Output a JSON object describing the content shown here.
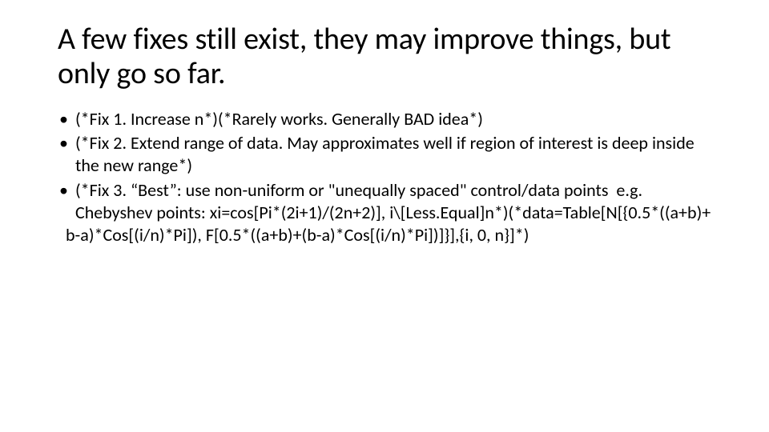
{
  "title": "A few fixes still exist, they may improve things, but only go so far.",
  "bullets": [
    "(*Fix 1. Increase n*)(*Rarely works. Generally BAD idea*)",
    "(*Fix 2. Extend range of data. May approximates well if region of interest is deep inside the new range*)",
    "(*Fix 3. “Best”: use non-uniform or \"unequally spaced\" control/data points  e.g.  Chebyshev points: xi=cos[Pi*(2i+1)/(2n+2)], i\\[Less.Equal]n*)(*data=Table[N[{0.5*((a+b)+"
  ],
  "continuation": "b-a)*Cos[(i/n)*Pi]), F[0.5*((a+b)+(b-a)*Cos[(i/n)*Pi])]}],{i, 0, n}]*)"
}
